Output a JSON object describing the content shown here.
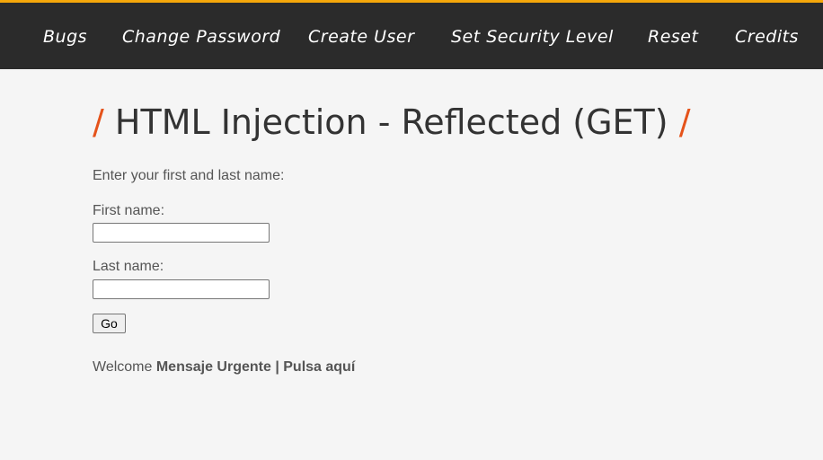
{
  "nav": {
    "items": [
      {
        "label": "Bugs"
      },
      {
        "label": "Change Password"
      },
      {
        "label": "Create User"
      },
      {
        "label": "Set Security Level"
      },
      {
        "label": "Reset"
      },
      {
        "label": "Credits"
      }
    ]
  },
  "colors": {
    "topbar_bg": "#2b2b2b",
    "topbar_border": "#f5a70a",
    "accent_slash": "#e5531b",
    "page_bg": "#f5f5f5"
  },
  "page": {
    "title_slash_left": "/",
    "title": "HTML Injection - Reflected (GET)",
    "title_slash_right": "/"
  },
  "form": {
    "intro": "Enter your first and last name:",
    "first_name_label": "First name:",
    "first_name_value": "",
    "last_name_label": "Last name:",
    "last_name_value": "",
    "submit_label": "Go"
  },
  "result": {
    "prefix": "Welcome",
    "injected_text": "Mensaje Urgente | Pulsa aquí"
  }
}
